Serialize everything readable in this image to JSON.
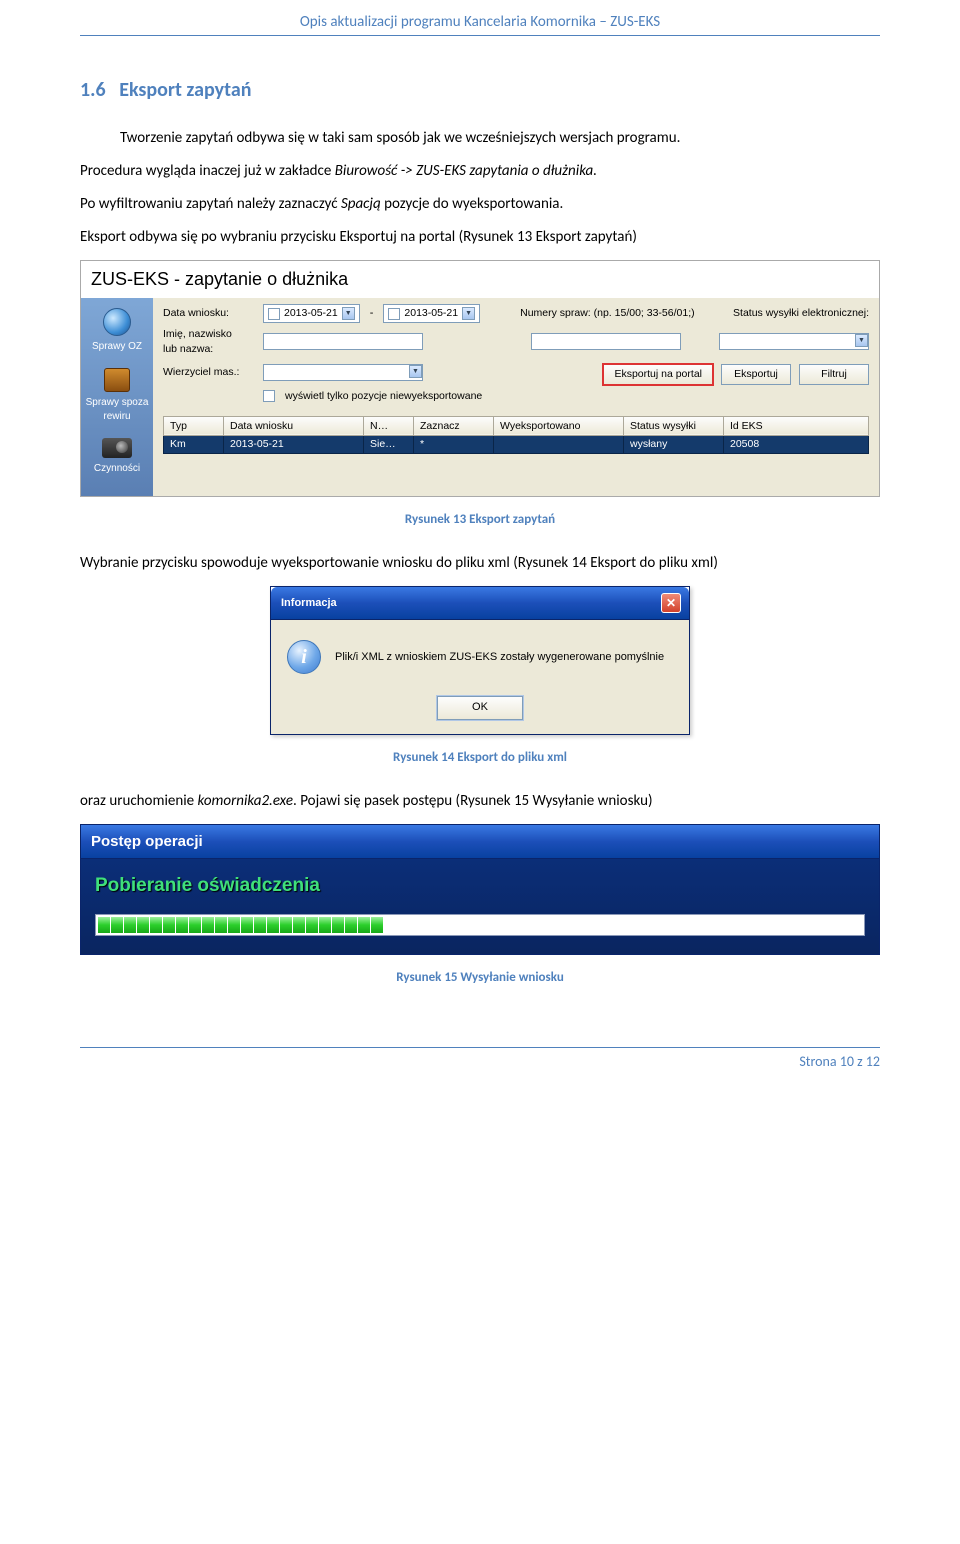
{
  "header": "Opis aktualizacji programu Kancelaria Komornika – ZUS-EKS",
  "section_number": "1.6",
  "section_title": "Eksport zapytań",
  "para1": "Tworzenie zapytań odbywa się w taki sam sposób jak we wcześniejszych wersjach programu.",
  "para2a": "Procedura wygląda inaczej już w zakładce ",
  "para2b": "Biurowość -> ZUS-EKS zapytania o dłużnika.",
  "para3a": "Po wyfiltrowaniu zapytań należy zaznaczyć ",
  "para3b": "Spacją",
  "para3c": " pozycje do wyeksportowania.",
  "para4": "Eksport odbywa się po wybraniu przycisku Eksportuj na portal (Rysunek 13 Eksport zapytań)",
  "caption1": "Rysunek 13 Eksport zapytań",
  "para5": "Wybranie przycisku spowoduje wyeksportowanie wniosku do pliku xml (Rysunek 14 Eksport do pliku xml)",
  "caption2": "Rysunek 14 Eksport do pliku xml",
  "para6a": "oraz uruchomienie ",
  "para6b": "komornika2.exe",
  "para6c": ". Pojawi się pasek postępu (Rysunek 15 Wysyłanie wniosku)",
  "caption3": "Rysunek 15 Wysyłanie wniosku",
  "footer": "Strona 10 z 12",
  "shot1": {
    "title": "ZUS-EKS - zapytanie o dłużnika",
    "side": {
      "a": "Sprawy OZ",
      "b": "Sprawy spoza\nrewiru",
      "c": "Czynności"
    },
    "form": {
      "l_date": "Data wniosku:",
      "date1": "2013-05-21",
      "dash": "-",
      "date2": "2013-05-21",
      "l_name": "Imię, nazwisko\nlub nazwa:",
      "l_wierz": "Wierzyciel mas.:",
      "chk_label": "wyświetl tylko pozycje niewyeksportowane",
      "l_num": "Numery spraw: (np. 15/00; 33-56/01;)",
      "l_status": "Status wysyłki elektronicznej:",
      "btn_portal": "Eksportuj na portal",
      "btn_eksport": "Eksportuj",
      "btn_filtruj": "Filtruj"
    },
    "cols": [
      "Typ",
      "Data wniosku",
      "N…",
      "Zaznacz",
      "Wyeksportowano",
      "Status wysyłki",
      "Id EKS"
    ],
    "row": [
      "Km",
      "2013-05-21",
      "Sie…",
      "*",
      "",
      "wysłany",
      "20508"
    ]
  },
  "shot2": {
    "title": "Informacja",
    "msg": "Plik/i XML z wnioskiem ZUS-EKS zostały wygenerowane pomyślnie",
    "ok": "OK"
  },
  "shot3": {
    "title": "Postęp operacji",
    "stage": "Pobieranie oświadczenia"
  }
}
